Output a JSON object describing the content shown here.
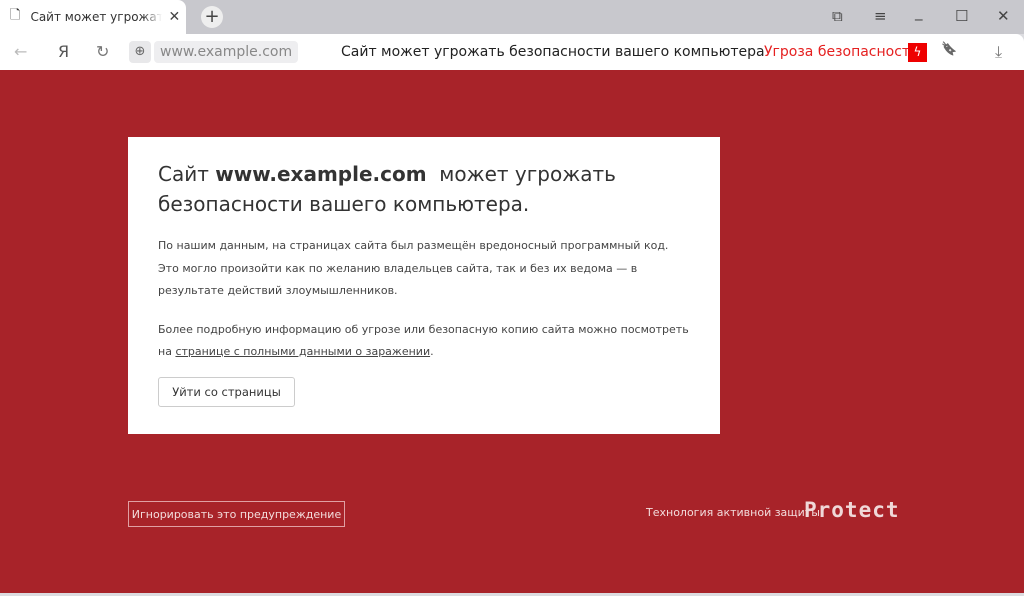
{
  "tab": {
    "title": "Сайт может угрожать безопасности вашего компьютера",
    "close": "✕",
    "new_tab": "+"
  },
  "window": {
    "bookmarks": "⧉",
    "menu": "≡",
    "minimize": "_",
    "maximize": "☐",
    "close": "✕"
  },
  "toolbar": {
    "back": "←",
    "yandex": "Я",
    "reload": "↻",
    "url": "www.example.com",
    "page_title": "Сайт может угрожать безопасности вашего компьютера",
    "threat_label": "Угроза безопасности",
    "bolt": "ϟ",
    "bookmark": "🔖",
    "download": "⤓",
    "globe": "⊕"
  },
  "card": {
    "title_prefix": "Сайт ",
    "title_domain": "www.example.com",
    "title_suffix": "  может угрожать безопасности вашего компьютера.",
    "para1": "По нашим данным, на страницах сайта был размещён вредоносный программный код. Это могло произойти как по желанию владельцев сайта, так и без их ведома — в результате действий злоумышленников.",
    "para2_prefix": "Более подробную информацию об угрозе или безопасную копию сайта можно посмотреть на ",
    "para2_link": "странице с полными данными о заражении",
    "para2_suffix": ".",
    "leave_button": "Уйти со страницы"
  },
  "footer": {
    "ignore_button": "Игнорировать это предупреждение",
    "tech_label": "Технология активной защиты",
    "brand": "Protect"
  }
}
